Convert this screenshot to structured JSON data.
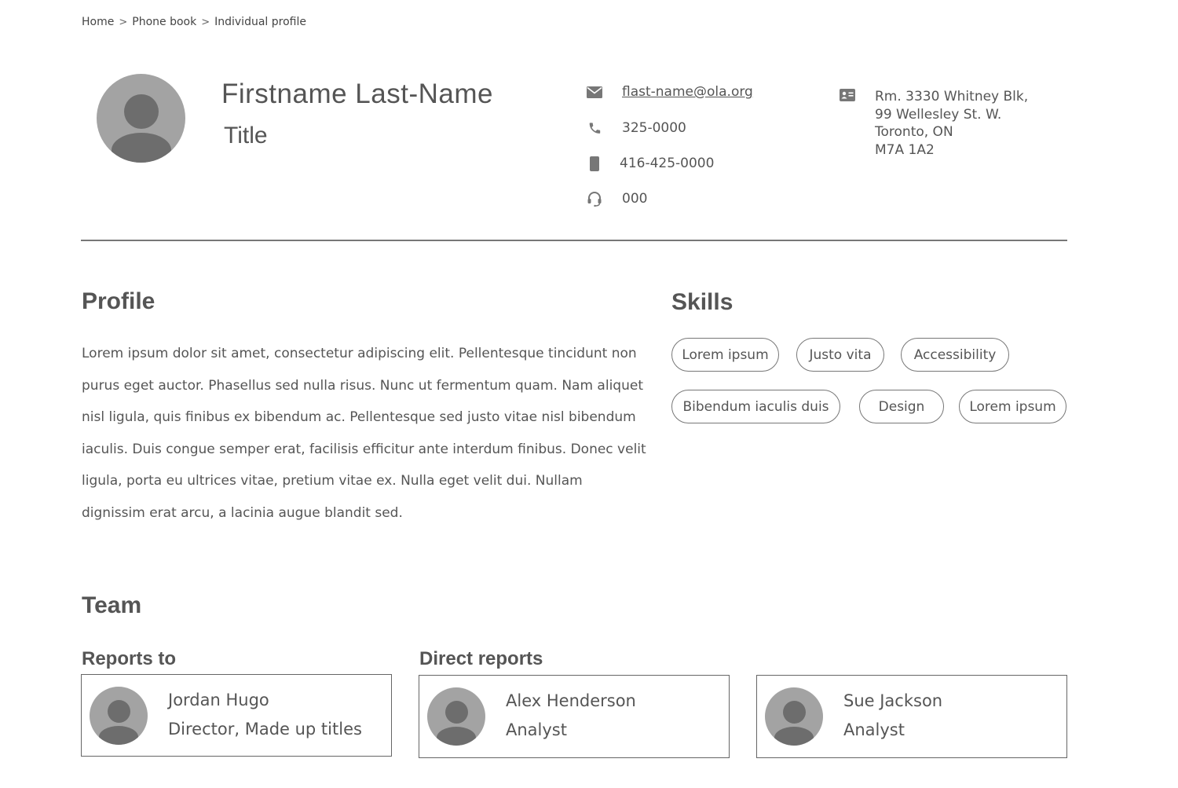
{
  "breadcrumb": {
    "items": [
      "Home",
      "Phone book",
      "Individual profile"
    ],
    "separator": ">"
  },
  "person": {
    "name": "Firstname Last-Name",
    "title": "Title"
  },
  "contact": {
    "email": "flast-name@ola.org",
    "phone": "325-0000",
    "mobile": "416-425-0000",
    "support": "000",
    "address": [
      "Rm. 3330 Whitney Blk,",
      "99 Wellesley St. W.",
      "Toronto, ON",
      "M7A 1A2"
    ]
  },
  "profile": {
    "heading": "Profile",
    "text": "Lorem ipsum dolor sit amet, consectetur adipiscing elit. Pellentesque tincidunt non purus eget auctor. Phasellus sed nulla risus. Nunc ut fermentum quam. Nam aliquet nisl ligula, quis finibus ex bibendum ac. Pellentesque sed justo vitae nisl bibendum iaculis. Duis congue semper erat, facilisis efficitur ante interdum finibus. Donec velit ligula, porta eu ultrices vitae, pretium vitae ex. Nulla eget velit dui. Nullam dignissim erat arcu, a lacinia augue blandit sed."
  },
  "skills": {
    "heading": "Skills",
    "items": [
      "Lorem ipsum",
      "Justo vita",
      "Accessibility",
      "Bibendum iaculis duis",
      "Design",
      "Lorem ipsum"
    ]
  },
  "team": {
    "heading": "Team",
    "reports_to_label": "Reports to",
    "direct_reports_label": "Direct reports",
    "reports_to": [
      {
        "name": "Jordan Hugo",
        "title": "Director, Made up titles"
      }
    ],
    "direct_reports": [
      {
        "name": "Alex Henderson",
        "title": "Analyst"
      },
      {
        "name": "Sue Jackson",
        "title": "Analyst"
      }
    ]
  },
  "colors": {
    "text": "#555555",
    "avatar_bg": "#a3a3a3",
    "avatar_fg": "#6d6d6d",
    "border": "#777777"
  }
}
